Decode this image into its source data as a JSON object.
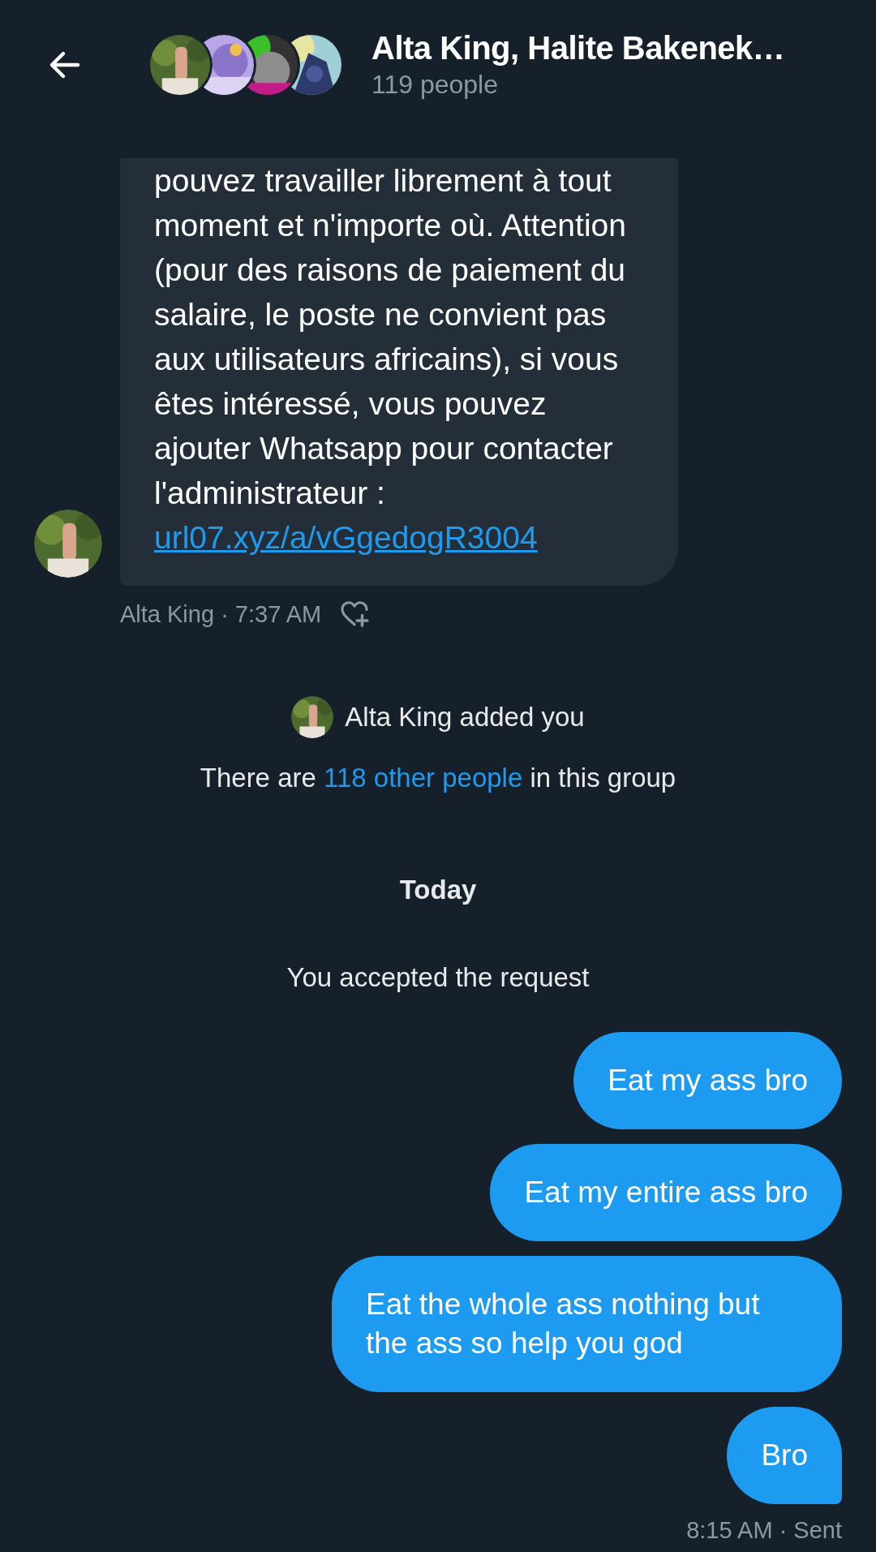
{
  "header": {
    "title": "Alta King, Halite Bakenek…",
    "subtitle": "119 people"
  },
  "conversation": [
    {
      "kind": "received",
      "text": "pouvez travailler librement à tout moment et n'importe où. Attention (pour des raisons de paiement du salaire, le poste ne convient pas aux utilisateurs africains), si vous êtes intéressé, vous pouvez ajouter Whatsapp pour contacter l'administrateur : ",
      "link": "url07.xyz/a/vGgedogR3004",
      "meta": "Alta King · 7:37 AM"
    },
    {
      "kind": "added",
      "text": "Alta King added you"
    },
    {
      "kind": "members",
      "before": "There are ",
      "link": "118 other people",
      "after": " in this group"
    },
    {
      "kind": "date",
      "text": "Today"
    },
    {
      "kind": "notice",
      "text": "You accepted the request"
    },
    {
      "kind": "sent",
      "text": "Eat my ass bro",
      "tail": false
    },
    {
      "kind": "sent",
      "text": "Eat my entire ass bro",
      "tail": false
    },
    {
      "kind": "sent",
      "text": "Eat the whole ass nothing but the ass so help you god",
      "tail": false
    },
    {
      "kind": "sent",
      "text": "Bro",
      "tail": true
    },
    {
      "kind": "status",
      "text": "8:15 AM · Sent"
    }
  ]
}
